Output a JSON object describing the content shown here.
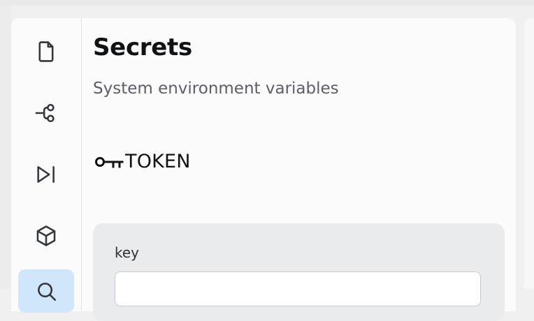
{
  "page": {
    "title": "Secrets",
    "subtitle": "System environment variables"
  },
  "secret": {
    "name": "TOKEN",
    "icon": "key-icon"
  },
  "form": {
    "key_label": "key",
    "key_value": ""
  },
  "sidebar": {
    "items": [
      {
        "icon": "file-icon"
      },
      {
        "icon": "git-commit-icon"
      },
      {
        "icon": "skip-forward-icon"
      },
      {
        "icon": "cube-icon"
      },
      {
        "icon": "search-icon"
      }
    ]
  }
}
